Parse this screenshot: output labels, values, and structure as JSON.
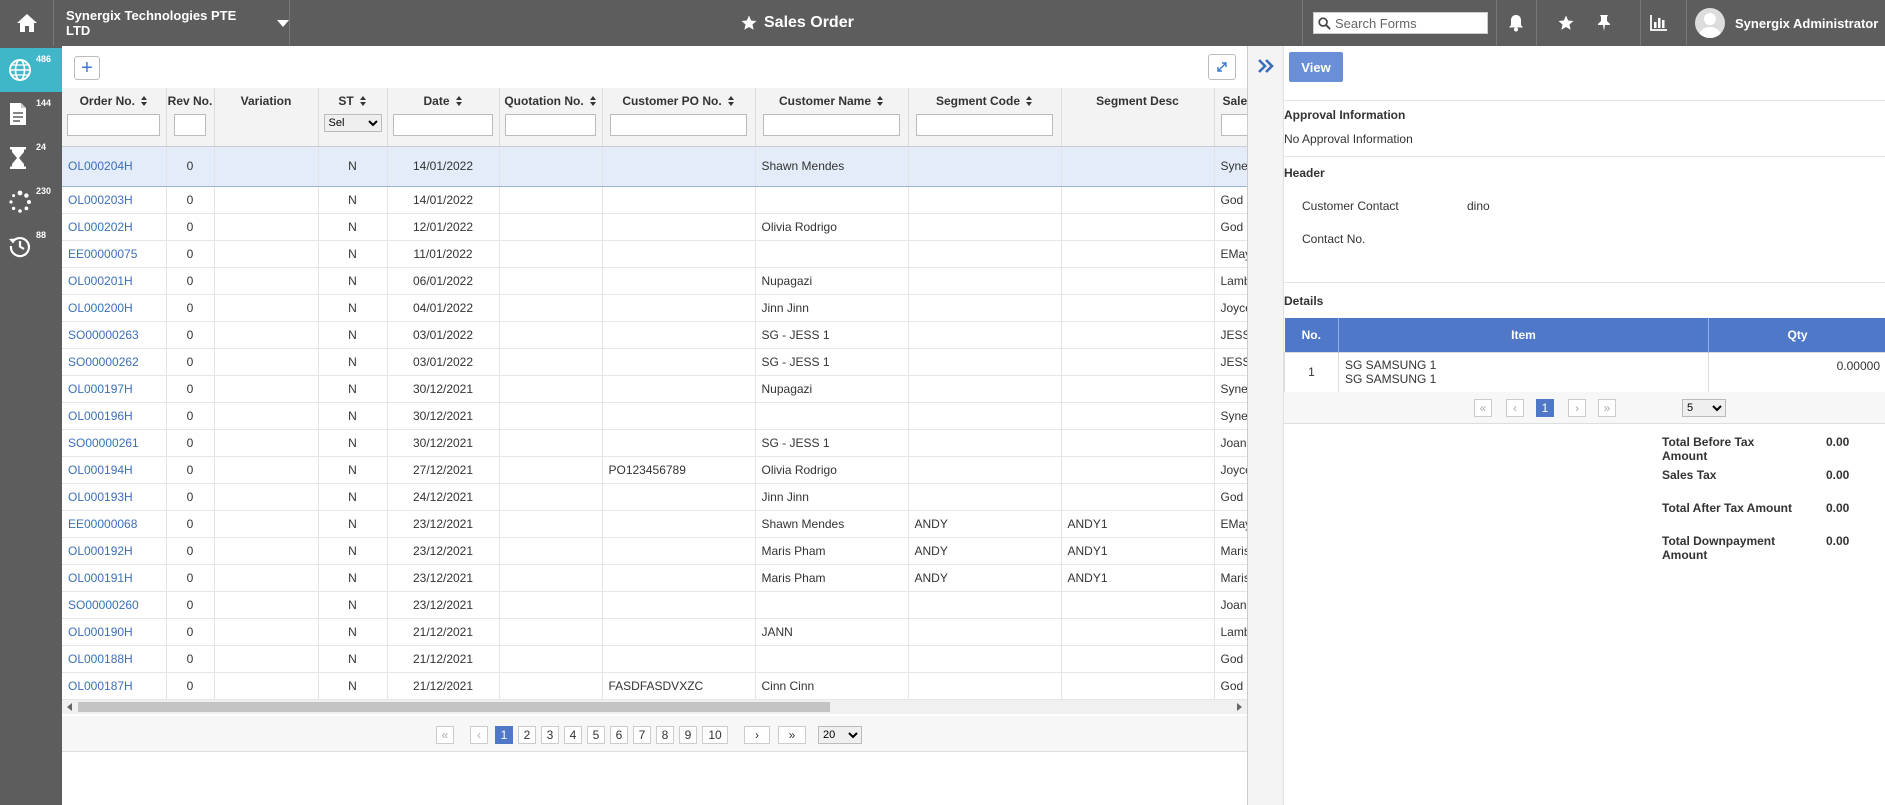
{
  "topbar": {
    "company": "Synergix Technologies PTE LTD",
    "title": "Sales Order",
    "search_placeholder": "Search Forms",
    "user": "Synergix Administrator"
  },
  "sidebar": {
    "items": [
      {
        "icon": "globe-icon",
        "badge": "486"
      },
      {
        "icon": "document-icon",
        "badge": "144"
      },
      {
        "icon": "hourglass-icon",
        "badge": "24"
      },
      {
        "icon": "spinner-icon",
        "badge": "230"
      },
      {
        "icon": "history-icon",
        "badge": "88"
      }
    ]
  },
  "toolbar": {
    "add_label": "+"
  },
  "grid": {
    "columns": [
      "Order No.",
      "Rev No.",
      "Variation",
      "ST",
      "Date",
      "Quotation No.",
      "Customer PO No.",
      "Customer Name",
      "Segment Code",
      "Segment Desc",
      "Sales"
    ],
    "st_filter_selected": "Sel",
    "rows": [
      {
        "order": "OL000204H",
        "rev": "0",
        "variation": "",
        "st": "N",
        "date": "14/01/2022",
        "quotation": "",
        "po": "",
        "customer": "Shawn Mendes",
        "seg_code": "",
        "seg_desc": "",
        "sales": "Syne Admi"
      },
      {
        "order": "OL000203H",
        "rev": "0",
        "variation": "",
        "st": "N",
        "date": "14/01/2022",
        "quotation": "",
        "po": "",
        "customer": "",
        "seg_code": "",
        "seg_desc": "",
        "sales": "God"
      },
      {
        "order": "OL000202H",
        "rev": "0",
        "variation": "",
        "st": "N",
        "date": "12/01/2022",
        "quotation": "",
        "po": "",
        "customer": "Olivia Rodrigo",
        "seg_code": "",
        "seg_desc": "",
        "sales": "God"
      },
      {
        "order": "EE00000075",
        "rev": "0",
        "variation": "",
        "st": "N",
        "date": "11/01/2022",
        "quotation": "",
        "po": "",
        "customer": "",
        "seg_code": "",
        "seg_desc": "",
        "sales": "EMay"
      },
      {
        "order": "OL000201H",
        "rev": "0",
        "variation": "",
        "st": "N",
        "date": "06/01/2022",
        "quotation": "",
        "po": "",
        "customer": "Nupagazi",
        "seg_code": "",
        "seg_desc": "",
        "sales": "Lamb"
      },
      {
        "order": "OL000200H",
        "rev": "0",
        "variation": "",
        "st": "N",
        "date": "04/01/2022",
        "quotation": "",
        "po": "",
        "customer": "Jinn Jinn",
        "seg_code": "",
        "seg_desc": "",
        "sales": "Joyce"
      },
      {
        "order": "SO00000263",
        "rev": "0",
        "variation": "",
        "st": "N",
        "date": "03/01/2022",
        "quotation": "",
        "po": "",
        "customer": "SG - JESS 1",
        "seg_code": "",
        "seg_desc": "",
        "sales": "JESS"
      },
      {
        "order": "SO00000262",
        "rev": "0",
        "variation": "",
        "st": "N",
        "date": "03/01/2022",
        "quotation": "",
        "po": "",
        "customer": "SG - JESS 1",
        "seg_code": "",
        "seg_desc": "",
        "sales": "JESS"
      },
      {
        "order": "OL000197H",
        "rev": "0",
        "variation": "",
        "st": "N",
        "date": "30/12/2021",
        "quotation": "",
        "po": "",
        "customer": "Nupagazi",
        "seg_code": "",
        "seg_desc": "",
        "sales": "Syne"
      },
      {
        "order": "OL000196H",
        "rev": "0",
        "variation": "",
        "st": "N",
        "date": "30/12/2021",
        "quotation": "",
        "po": "",
        "customer": "",
        "seg_code": "",
        "seg_desc": "",
        "sales": "Syne"
      },
      {
        "order": "SO00000261",
        "rev": "0",
        "variation": "",
        "st": "N",
        "date": "30/12/2021",
        "quotation": "",
        "po": "",
        "customer": "SG - JESS 1",
        "seg_code": "",
        "seg_desc": "",
        "sales": "Joan"
      },
      {
        "order": "OL000194H",
        "rev": "0",
        "variation": "",
        "st": "N",
        "date": "27/12/2021",
        "quotation": "",
        "po": "PO123456789",
        "customer": "Olivia Rodrigo",
        "seg_code": "",
        "seg_desc": "",
        "sales": "Joyce"
      },
      {
        "order": "OL000193H",
        "rev": "0",
        "variation": "",
        "st": "N",
        "date": "24/12/2021",
        "quotation": "",
        "po": "",
        "customer": "Jinn Jinn",
        "seg_code": "",
        "seg_desc": "",
        "sales": "God"
      },
      {
        "order": "EE00000068",
        "rev": "0",
        "variation": "",
        "st": "N",
        "date": "23/12/2021",
        "quotation": "",
        "po": "",
        "customer": "Shawn Mendes",
        "seg_code": "ANDY",
        "seg_desc": "ANDY1",
        "sales": "EMay"
      },
      {
        "order": "OL000192H",
        "rev": "0",
        "variation": "",
        "st": "N",
        "date": "23/12/2021",
        "quotation": "",
        "po": "",
        "customer": "Maris Pham",
        "seg_code": "ANDY",
        "seg_desc": "ANDY1",
        "sales": "Maris"
      },
      {
        "order": "OL000191H",
        "rev": "0",
        "variation": "",
        "st": "N",
        "date": "23/12/2021",
        "quotation": "",
        "po": "",
        "customer": "Maris Pham",
        "seg_code": "ANDY",
        "seg_desc": "ANDY1",
        "sales": "Maris"
      },
      {
        "order": "SO00000260",
        "rev": "0",
        "variation": "",
        "st": "N",
        "date": "23/12/2021",
        "quotation": "",
        "po": "",
        "customer": "",
        "seg_code": "",
        "seg_desc": "",
        "sales": "Joan"
      },
      {
        "order": "OL000190H",
        "rev": "0",
        "variation": "",
        "st": "N",
        "date": "21/12/2021",
        "quotation": "",
        "po": "",
        "customer": "JANN",
        "seg_code": "",
        "seg_desc": "",
        "sales": "Lamb"
      },
      {
        "order": "OL000188H",
        "rev": "0",
        "variation": "",
        "st": "N",
        "date": "21/12/2021",
        "quotation": "",
        "po": "",
        "customer": "",
        "seg_code": "",
        "seg_desc": "",
        "sales": "God"
      },
      {
        "order": "OL000187H",
        "rev": "0",
        "variation": "",
        "st": "N",
        "date": "21/12/2021",
        "quotation": "",
        "po": "FASDFASDVXZC",
        "customer": "Cinn Cinn",
        "seg_code": "",
        "seg_desc": "",
        "sales": "God"
      }
    ]
  },
  "pager": {
    "first": "«",
    "prev": "‹",
    "next": "›",
    "last": "»",
    "pages": [
      "1",
      "2",
      "3",
      "4",
      "5",
      "6",
      "7",
      "8",
      "9",
      "10"
    ],
    "current": "1",
    "page_size": "20"
  },
  "panel": {
    "view_label": "View",
    "approval_heading": "Approval Information",
    "approval_text": "No Approval Information",
    "header_heading": "Header",
    "customer_contact_label": "Customer Contact",
    "customer_contact_value": "dino",
    "contact_no_label": "Contact No.",
    "details_heading": "Details",
    "detail_columns": [
      "No.",
      "Item",
      "Qty"
    ],
    "detail_rows": [
      {
        "no": "1",
        "item_line1": "SG SAMSUNG 1",
        "item_line2": "SG SAMSUNG 1",
        "qty": "0.00000"
      }
    ],
    "detail_pager": {
      "first": "«",
      "prev": "‹",
      "page": "1",
      "next": "›",
      "last": "»",
      "page_size": "5"
    },
    "totals": [
      {
        "label": "Total Before Tax Amount",
        "value": "0.00"
      },
      {
        "label": "Sales Tax",
        "value": "0.00"
      },
      {
        "label": "Total After Tax Amount",
        "value": "0.00"
      },
      {
        "label": "Total Downpayment Amount",
        "value": "0.00"
      }
    ]
  },
  "colors": {
    "topbar": "#5d5d5d",
    "sidebar_active": "#3fb7c8",
    "link": "#3b6fb8",
    "accent": "#4f79c8"
  }
}
